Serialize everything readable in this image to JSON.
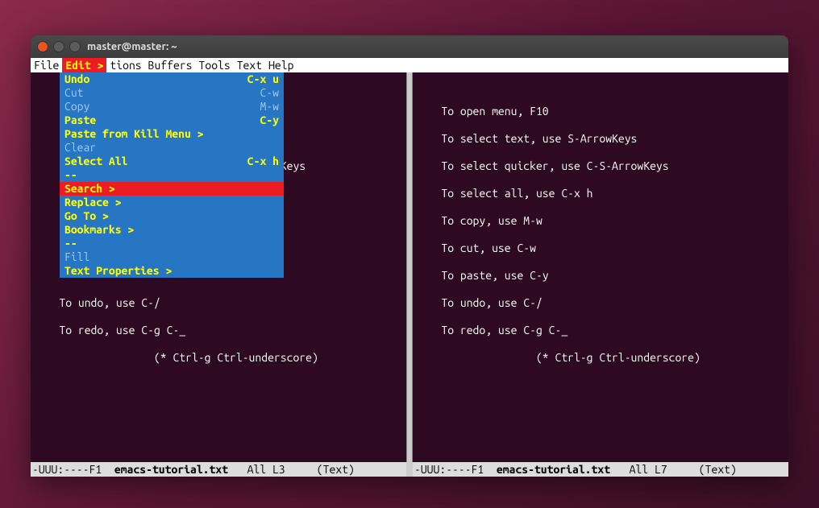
{
  "window": {
    "title": "master@master: ~"
  },
  "menubar": {
    "items": [
      "File",
      "Edit >",
      "tions",
      "Buffers",
      "Tools",
      "Text",
      "Help"
    ],
    "activeIndex": 1
  },
  "dropdown": {
    "items": [
      {
        "label": "Undo",
        "shortcut": "C-x u",
        "enabled": true
      },
      {
        "label": "Cut",
        "shortcut": "C-w",
        "enabled": false
      },
      {
        "label": "Copy",
        "shortcut": "M-w",
        "enabled": false
      },
      {
        "label": "Paste",
        "shortcut": "C-y",
        "enabled": true
      },
      {
        "label": "Paste from Kill Menu >",
        "shortcut": "",
        "enabled": true
      },
      {
        "label": "Clear",
        "shortcut": "",
        "enabled": false
      },
      {
        "label": "Select All",
        "shortcut": "C-x h",
        "enabled": true
      },
      {
        "type": "separator",
        "label": "--"
      },
      {
        "label": "Search >",
        "shortcut": "",
        "enabled": true,
        "highlighted": true
      },
      {
        "label": "Replace >",
        "shortcut": "",
        "enabled": true
      },
      {
        "label": "Go To >",
        "shortcut": "",
        "enabled": true
      },
      {
        "label": "Bookmarks >",
        "shortcut": "",
        "enabled": true
      },
      {
        "type": "separator",
        "label": "--"
      },
      {
        "label": "Fill",
        "shortcut": "",
        "enabled": false
      },
      {
        "label": "Text Properties >",
        "shortcut": "",
        "enabled": true
      }
    ]
  },
  "leftPane": {
    "visibleLines": [
      "",
      "",
      "",
      "",
      "                                  Keys",
      "",
      "                                  ArrowKeys",
      "",
      "",
      "",
      "",
      "",
      "",
      "",
      "",
      "",
      "    To undo, use C-/",
      "",
      "    To redo, use C-g C-_",
      "",
      "                   (* Ctrl-g Ctrl-underscore)"
    ]
  },
  "rightPane": {
    "lines": [
      "",
      "",
      "    To open menu, F10",
      "",
      "    To select text, use S-ArrowKeys",
      "",
      "    To select quicker, use C-S-ArrowKeys",
      "",
      "    To select all, use C-x h",
      "",
      "    To copy, use M-w",
      "",
      "    To cut, use C-w",
      "",
      "    To paste, use C-y",
      "",
      "    To undo, use C-/",
      "",
      "    To redo, use C-g C-_",
      "",
      "                   (* Ctrl-g Ctrl-underscore)"
    ]
  },
  "statusbar": {
    "left": {
      "prefix": "-UUU:----F1  ",
      "filename": "emacs-tutorial.txt",
      "suffix": "   All L3     (Text)"
    },
    "right": {
      "prefix": "-UUU:----F1  ",
      "filename": "emacs-tutorial.txt",
      "suffix": "   All L7     (Text)"
    }
  }
}
